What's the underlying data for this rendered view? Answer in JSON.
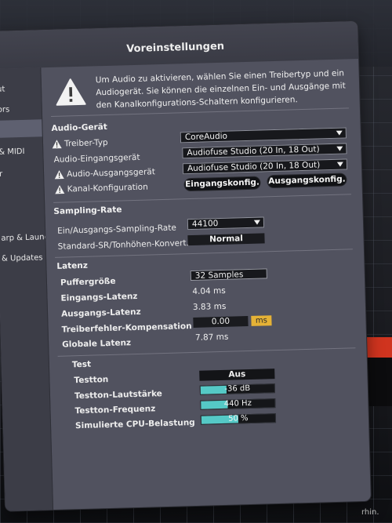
{
  "window": {
    "title": "Voreinstellungen"
  },
  "sidebar": {
    "items": [
      {
        "label": "ut",
        "selected": false
      },
      {
        "label": "ors",
        "selected": false
      },
      {
        "label": "",
        "selected": true
      },
      {
        "label": "& MIDI",
        "selected": false
      },
      {
        "label": "r",
        "selected": false
      },
      {
        "label": "arp & Launch",
        "selected": false
      },
      {
        "label": "& Updates",
        "selected": false
      }
    ]
  },
  "intro": {
    "text": "Um Audio zu aktivieren, wählen Sie einen Treibertyp und ein Audiogerät. Sie können die einzelnen Ein- und Ausgänge mit den Kanalkonfigurations-Schaltern konfigurieren."
  },
  "audio_device": {
    "section": "Audio-Gerät",
    "driver_label": "Treiber-Typ",
    "driver_value": "CoreAudio",
    "input_label": "Audio-Eingangsgerät",
    "input_value": "Audiofuse Studio (20 In, 18 Out)",
    "output_label": "Audio-Ausgangsgerät",
    "output_value": "Audiofuse Studio (20 In, 18 Out)",
    "channel_label": "Kanal-Konfiguration",
    "input_config_button": "Eingangskonfig.",
    "output_config_button": "Ausgangskonfig."
  },
  "sampling": {
    "section": "Sampling-Rate",
    "rate_label": "Ein/Ausgangs-Sampling-Rate",
    "rate_value": "44100",
    "sr_label": "Standard-SR/Tonhöhen-Konvert.",
    "sr_value": "Normal"
  },
  "latency": {
    "section": "Latenz",
    "buffer_label": "Puffergröße",
    "buffer_value": "32 Samples",
    "input_label": "Eingangs-Latenz",
    "input_value": "4.04 ms",
    "output_label": "Ausgangs-Latenz",
    "output_value": "3.83 ms",
    "comp_label": "Treiberfehler-Kompensation",
    "comp_value": "0.00",
    "comp_unit": "ms",
    "overall_label": "Globale Latenz",
    "overall_value": "7.87 ms"
  },
  "test": {
    "section": "Test",
    "tone_label": "Testton",
    "tone_value": "Aus",
    "volume_label": "Testton-Lautstärke",
    "volume_value": "-36 dB",
    "volume_level": 0.35,
    "freq_label": "Testton-Frequenz",
    "freq_value": "440 Hz",
    "freq_level": 0.36,
    "cpu_label": "Simulierte CPU-Belastung",
    "cpu_value": "50 %",
    "cpu_level": 0.5
  },
  "background": {
    "partial_text": "rhin."
  },
  "colors": {
    "accent_teal": "#55c9c6",
    "ms_yellow": "#e5b236",
    "window_bg": "#51525f"
  }
}
